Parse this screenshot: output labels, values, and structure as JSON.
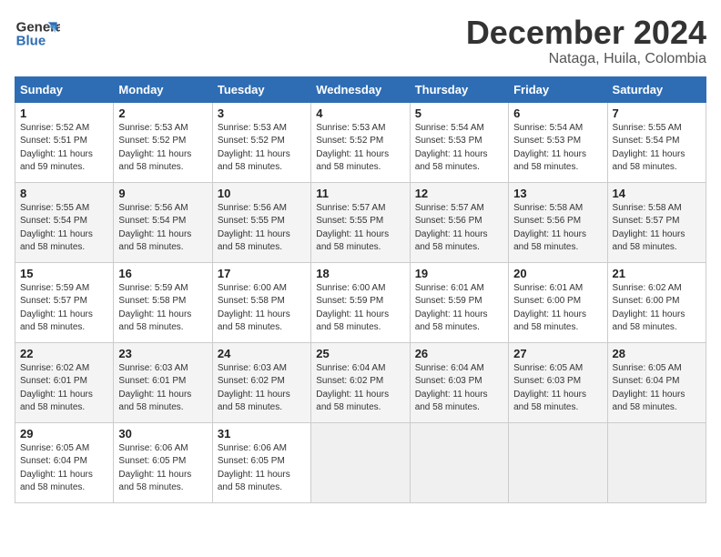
{
  "header": {
    "logo_line1": "General",
    "logo_line2": "Blue",
    "month": "December 2024",
    "location": "Nataga, Huila, Colombia"
  },
  "days_of_week": [
    "Sunday",
    "Monday",
    "Tuesday",
    "Wednesday",
    "Thursday",
    "Friday",
    "Saturday"
  ],
  "weeks": [
    [
      {
        "day": 1,
        "info": "Sunrise: 5:52 AM\nSunset: 5:51 PM\nDaylight: 11 hours\nand 59 minutes."
      },
      {
        "day": 2,
        "info": "Sunrise: 5:53 AM\nSunset: 5:52 PM\nDaylight: 11 hours\nand 58 minutes."
      },
      {
        "day": 3,
        "info": "Sunrise: 5:53 AM\nSunset: 5:52 PM\nDaylight: 11 hours\nand 58 minutes."
      },
      {
        "day": 4,
        "info": "Sunrise: 5:53 AM\nSunset: 5:52 PM\nDaylight: 11 hours\nand 58 minutes."
      },
      {
        "day": 5,
        "info": "Sunrise: 5:54 AM\nSunset: 5:53 PM\nDaylight: 11 hours\nand 58 minutes."
      },
      {
        "day": 6,
        "info": "Sunrise: 5:54 AM\nSunset: 5:53 PM\nDaylight: 11 hours\nand 58 minutes."
      },
      {
        "day": 7,
        "info": "Sunrise: 5:55 AM\nSunset: 5:54 PM\nDaylight: 11 hours\nand 58 minutes."
      }
    ],
    [
      {
        "day": 8,
        "info": "Sunrise: 5:55 AM\nSunset: 5:54 PM\nDaylight: 11 hours\nand 58 minutes."
      },
      {
        "day": 9,
        "info": "Sunrise: 5:56 AM\nSunset: 5:54 PM\nDaylight: 11 hours\nand 58 minutes."
      },
      {
        "day": 10,
        "info": "Sunrise: 5:56 AM\nSunset: 5:55 PM\nDaylight: 11 hours\nand 58 minutes."
      },
      {
        "day": 11,
        "info": "Sunrise: 5:57 AM\nSunset: 5:55 PM\nDaylight: 11 hours\nand 58 minutes."
      },
      {
        "day": 12,
        "info": "Sunrise: 5:57 AM\nSunset: 5:56 PM\nDaylight: 11 hours\nand 58 minutes."
      },
      {
        "day": 13,
        "info": "Sunrise: 5:58 AM\nSunset: 5:56 PM\nDaylight: 11 hours\nand 58 minutes."
      },
      {
        "day": 14,
        "info": "Sunrise: 5:58 AM\nSunset: 5:57 PM\nDaylight: 11 hours\nand 58 minutes."
      }
    ],
    [
      {
        "day": 15,
        "info": "Sunrise: 5:59 AM\nSunset: 5:57 PM\nDaylight: 11 hours\nand 58 minutes."
      },
      {
        "day": 16,
        "info": "Sunrise: 5:59 AM\nSunset: 5:58 PM\nDaylight: 11 hours\nand 58 minutes."
      },
      {
        "day": 17,
        "info": "Sunrise: 6:00 AM\nSunset: 5:58 PM\nDaylight: 11 hours\nand 58 minutes."
      },
      {
        "day": 18,
        "info": "Sunrise: 6:00 AM\nSunset: 5:59 PM\nDaylight: 11 hours\nand 58 minutes."
      },
      {
        "day": 19,
        "info": "Sunrise: 6:01 AM\nSunset: 5:59 PM\nDaylight: 11 hours\nand 58 minutes."
      },
      {
        "day": 20,
        "info": "Sunrise: 6:01 AM\nSunset: 6:00 PM\nDaylight: 11 hours\nand 58 minutes."
      },
      {
        "day": 21,
        "info": "Sunrise: 6:02 AM\nSunset: 6:00 PM\nDaylight: 11 hours\nand 58 minutes."
      }
    ],
    [
      {
        "day": 22,
        "info": "Sunrise: 6:02 AM\nSunset: 6:01 PM\nDaylight: 11 hours\nand 58 minutes."
      },
      {
        "day": 23,
        "info": "Sunrise: 6:03 AM\nSunset: 6:01 PM\nDaylight: 11 hours\nand 58 minutes."
      },
      {
        "day": 24,
        "info": "Sunrise: 6:03 AM\nSunset: 6:02 PM\nDaylight: 11 hours\nand 58 minutes."
      },
      {
        "day": 25,
        "info": "Sunrise: 6:04 AM\nSunset: 6:02 PM\nDaylight: 11 hours\nand 58 minutes."
      },
      {
        "day": 26,
        "info": "Sunrise: 6:04 AM\nSunset: 6:03 PM\nDaylight: 11 hours\nand 58 minutes."
      },
      {
        "day": 27,
        "info": "Sunrise: 6:05 AM\nSunset: 6:03 PM\nDaylight: 11 hours\nand 58 minutes."
      },
      {
        "day": 28,
        "info": "Sunrise: 6:05 AM\nSunset: 6:04 PM\nDaylight: 11 hours\nand 58 minutes."
      }
    ],
    [
      {
        "day": 29,
        "info": "Sunrise: 6:05 AM\nSunset: 6:04 PM\nDaylight: 11 hours\nand 58 minutes."
      },
      {
        "day": 30,
        "info": "Sunrise: 6:06 AM\nSunset: 6:05 PM\nDaylight: 11 hours\nand 58 minutes."
      },
      {
        "day": 31,
        "info": "Sunrise: 6:06 AM\nSunset: 6:05 PM\nDaylight: 11 hours\nand 58 minutes."
      },
      null,
      null,
      null,
      null
    ]
  ]
}
